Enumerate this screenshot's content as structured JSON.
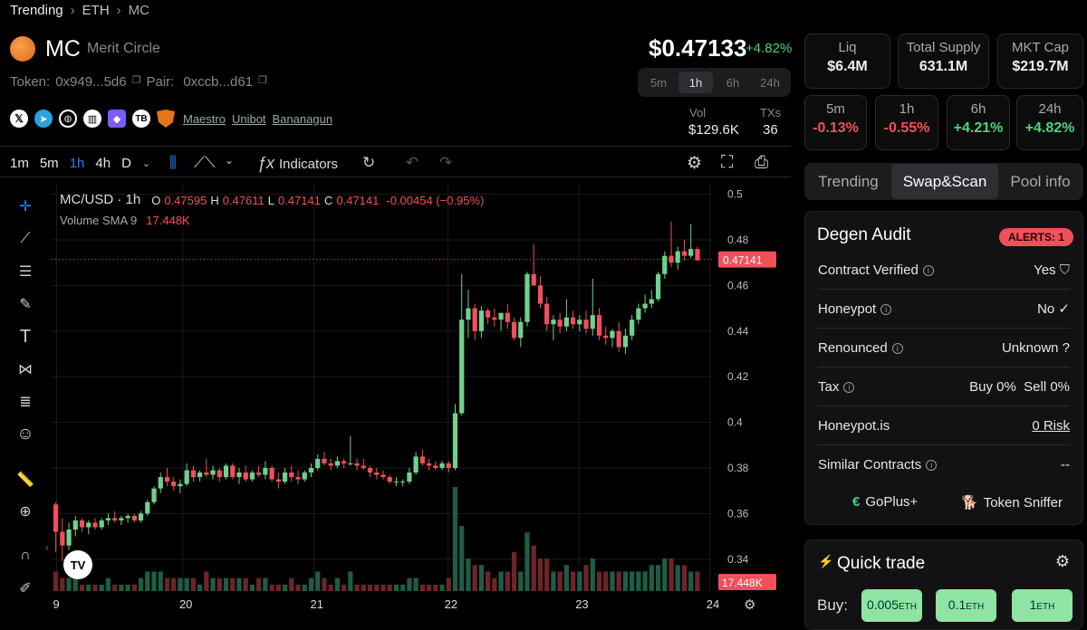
{
  "breadcrumb": {
    "items": [
      "Trending",
      "ETH",
      "MC"
    ]
  },
  "token": {
    "symbol": "MC",
    "name": "Merit Circle",
    "token_label": "Token:",
    "token_addr": "0x949...5d6",
    "pair_label": "Pair:",
    "pair_addr": "0xccb...d61",
    "price": "$0.47133",
    "change": "+4.82%"
  },
  "links": [
    "Maestro",
    "Unibot",
    "Bananagun"
  ],
  "timeframes": {
    "options": [
      "5m",
      "1h",
      "6h",
      "24h"
    ],
    "selected": "1h"
  },
  "vol": {
    "label": "Vol",
    "value": "$129.6K"
  },
  "txs": {
    "label": "TXs",
    "value": "36"
  },
  "stats_top": [
    {
      "label": "Liq",
      "value": "$6.4M"
    },
    {
      "label": "Total Supply",
      "value": "631.1M"
    },
    {
      "label": "MKT Cap",
      "value": "$219.7M"
    }
  ],
  "stats_changes": [
    {
      "label": "5m",
      "value": "-0.13%",
      "dir": "down"
    },
    {
      "label": "1h",
      "value": "-0.55%",
      "dir": "down"
    },
    {
      "label": "6h",
      "value": "+4.21%",
      "dir": "up"
    },
    {
      "label": "24h",
      "value": "+4.82%",
      "dir": "up"
    }
  ],
  "panel_tabs": {
    "items": [
      "Trending",
      "Swap&Scan",
      "Pool info"
    ],
    "selected": "Swap&Scan"
  },
  "audit": {
    "title": "Degen Audit",
    "alerts": "ALERTS: 1",
    "rows": [
      {
        "label": "Contract Verified",
        "value": "Yes",
        "mark": "shield"
      },
      {
        "label": "Honeypot",
        "value": "No",
        "mark": "check"
      },
      {
        "label": "Renounced",
        "value": "Unknown ?",
        "mark": ""
      },
      {
        "label": "Tax",
        "value": "Buy 0%  Sell 0%",
        "mark": ""
      },
      {
        "label": "Honeypot.is",
        "value": "0 Risk",
        "mark": "link"
      },
      {
        "label": "Similar Contracts",
        "value": "--",
        "mark": ""
      }
    ],
    "providers": [
      "GoPlus+",
      "Token Sniffer"
    ]
  },
  "quick_trade": {
    "title": "Quick trade",
    "buy_label": "Buy:",
    "amounts": [
      {
        "num": "0.005",
        "unit": "ETH"
      },
      {
        "num": "0.1",
        "unit": "ETH"
      },
      {
        "num": "1",
        "unit": "ETH"
      }
    ]
  },
  "chart_toolbar": {
    "intervals": [
      "1m",
      "5m",
      "1h",
      "4h",
      "D"
    ],
    "selected_interval": "1h",
    "indicators_label": "Indicators"
  },
  "legend": {
    "pair": "MC/USD · 1h",
    "o_label": "O",
    "o": "0.47595",
    "h_label": "H",
    "h": "0.47611",
    "l_label": "L",
    "l": "0.47141",
    "c_label": "C",
    "c": "0.47141",
    "change": "-0.00454 (−0.95%)",
    "volume_label": "Volume SMA 9",
    "volume_value": "17.448K"
  },
  "chart_data": {
    "type": "candlestick",
    "y_ticks": [
      "0.5",
      "0.48",
      "0.46",
      "0.44",
      "0.42",
      "0.4",
      "0.38",
      "0.36",
      "0.34"
    ],
    "ylim": [
      0.328,
      0.505
    ],
    "x_ticks": [
      "9",
      "20",
      "21",
      "22",
      "23",
      "24"
    ],
    "last_price_label": "0.47141",
    "last_volume_label": "17.448K",
    "candles": [
      [
        0.364,
        0.365,
        0.343,
        0.352
      ],
      [
        0.352,
        0.358,
        0.339,
        0.346
      ],
      [
        0.346,
        0.356,
        0.344,
        0.353
      ],
      [
        0.353,
        0.359,
        0.35,
        0.357
      ],
      [
        0.357,
        0.358,
        0.352,
        0.354
      ],
      [
        0.354,
        0.357,
        0.351,
        0.356
      ],
      [
        0.356,
        0.358,
        0.353,
        0.354
      ],
      [
        0.354,
        0.358,
        0.353,
        0.357
      ],
      [
        0.357,
        0.36,
        0.355,
        0.358
      ],
      [
        0.358,
        0.361,
        0.356,
        0.357
      ],
      [
        0.357,
        0.359,
        0.355,
        0.358
      ],
      [
        0.358,
        0.36,
        0.356,
        0.359
      ],
      [
        0.359,
        0.36,
        0.356,
        0.357
      ],
      [
        0.357,
        0.361,
        0.356,
        0.36
      ],
      [
        0.36,
        0.366,
        0.359,
        0.365
      ],
      [
        0.365,
        0.372,
        0.364,
        0.371
      ],
      [
        0.371,
        0.378,
        0.369,
        0.376
      ],
      [
        0.376,
        0.38,
        0.372,
        0.374
      ],
      [
        0.374,
        0.376,
        0.37,
        0.372
      ],
      [
        0.372,
        0.375,
        0.369,
        0.373
      ],
      [
        0.373,
        0.382,
        0.372,
        0.379
      ],
      [
        0.379,
        0.381,
        0.374,
        0.376
      ],
      [
        0.376,
        0.379,
        0.374,
        0.378
      ],
      [
        0.378,
        0.384,
        0.376,
        0.377
      ],
      [
        0.377,
        0.381,
        0.375,
        0.379
      ],
      [
        0.379,
        0.38,
        0.374,
        0.376
      ],
      [
        0.376,
        0.382,
        0.375,
        0.381
      ],
      [
        0.381,
        0.382,
        0.375,
        0.376
      ],
      [
        0.376,
        0.38,
        0.373,
        0.378
      ],
      [
        0.378,
        0.381,
        0.374,
        0.375
      ],
      [
        0.375,
        0.379,
        0.374,
        0.378
      ],
      [
        0.378,
        0.381,
        0.376,
        0.377
      ],
      [
        0.377,
        0.383,
        0.375,
        0.38
      ],
      [
        0.38,
        0.381,
        0.374,
        0.375
      ],
      [
        0.375,
        0.378,
        0.371,
        0.374
      ],
      [
        0.374,
        0.38,
        0.373,
        0.378
      ],
      [
        0.378,
        0.381,
        0.374,
        0.376
      ],
      [
        0.376,
        0.379,
        0.373,
        0.375
      ],
      [
        0.375,
        0.379,
        0.374,
        0.378
      ],
      [
        0.378,
        0.382,
        0.376,
        0.38
      ],
      [
        0.38,
        0.386,
        0.379,
        0.384
      ],
      [
        0.384,
        0.387,
        0.381,
        0.382
      ],
      [
        0.382,
        0.384,
        0.379,
        0.381
      ],
      [
        0.381,
        0.385,
        0.38,
        0.383
      ],
      [
        0.383,
        0.384,
        0.38,
        0.382
      ],
      [
        0.382,
        0.394,
        0.381,
        0.382
      ],
      [
        0.382,
        0.384,
        0.379,
        0.381
      ],
      [
        0.381,
        0.384,
        0.379,
        0.38
      ],
      [
        0.38,
        0.381,
        0.376,
        0.378
      ],
      [
        0.378,
        0.38,
        0.375,
        0.377
      ],
      [
        0.377,
        0.379,
        0.375,
        0.376
      ],
      [
        0.376,
        0.377,
        0.373,
        0.374
      ],
      [
        0.374,
        0.376,
        0.372,
        0.374
      ],
      [
        0.374,
        0.375,
        0.372,
        0.374
      ],
      [
        0.374,
        0.38,
        0.373,
        0.378
      ],
      [
        0.378,
        0.387,
        0.377,
        0.385
      ],
      [
        0.385,
        0.388,
        0.381,
        0.382
      ],
      [
        0.382,
        0.384,
        0.379,
        0.381
      ],
      [
        0.381,
        0.383,
        0.379,
        0.38
      ],
      [
        0.38,
        0.383,
        0.379,
        0.382
      ],
      [
        0.382,
        0.383,
        0.378,
        0.38
      ],
      [
        0.38,
        0.408,
        0.379,
        0.404
      ],
      [
        0.404,
        0.465,
        0.403,
        0.445
      ],
      [
        0.445,
        0.458,
        0.437,
        0.45
      ],
      [
        0.45,
        0.452,
        0.436,
        0.44
      ],
      [
        0.44,
        0.451,
        0.437,
        0.449
      ],
      [
        0.449,
        0.45,
        0.443,
        0.446
      ],
      [
        0.446,
        0.45,
        0.442,
        0.445
      ],
      [
        0.445,
        0.447,
        0.44,
        0.448
      ],
      [
        0.448,
        0.452,
        0.441,
        0.444
      ],
      [
        0.444,
        0.446,
        0.436,
        0.437
      ],
      [
        0.437,
        0.446,
        0.433,
        0.444
      ],
      [
        0.444,
        0.466,
        0.442,
        0.465
      ],
      [
        0.465,
        0.478,
        0.462,
        0.46
      ],
      [
        0.46,
        0.464,
        0.45,
        0.452
      ],
      [
        0.452,
        0.455,
        0.44,
        0.443
      ],
      [
        0.443,
        0.447,
        0.436,
        0.445
      ],
      [
        0.445,
        0.448,
        0.439,
        0.442
      ],
      [
        0.442,
        0.454,
        0.44,
        0.446
      ],
      [
        0.446,
        0.449,
        0.441,
        0.443
      ],
      [
        0.443,
        0.447,
        0.44,
        0.445
      ],
      [
        0.445,
        0.449,
        0.439,
        0.441
      ],
      [
        0.441,
        0.463,
        0.438,
        0.447
      ],
      [
        0.447,
        0.45,
        0.436,
        0.438
      ],
      [
        0.438,
        0.442,
        0.434,
        0.437
      ],
      [
        0.437,
        0.441,
        0.433,
        0.44
      ],
      [
        0.44,
        0.444,
        0.431,
        0.433
      ],
      [
        0.433,
        0.441,
        0.43,
        0.438
      ],
      [
        0.438,
        0.447,
        0.436,
        0.445
      ],
      [
        0.445,
        0.452,
        0.443,
        0.45
      ],
      [
        0.45,
        0.456,
        0.448,
        0.452
      ],
      [
        0.452,
        0.458,
        0.45,
        0.454
      ],
      [
        0.454,
        0.466,
        0.453,
        0.465
      ],
      [
        0.465,
        0.475,
        0.463,
        0.473
      ],
      [
        0.473,
        0.488,
        0.468,
        0.47
      ],
      [
        0.47,
        0.477,
        0.467,
        0.475
      ],
      [
        0.475,
        0.48,
        0.471,
        0.473
      ],
      [
        0.473,
        0.487,
        0.472,
        0.476
      ],
      [
        0.476,
        0.477,
        0.471,
        0.471
      ]
    ],
    "volumes": [
      0.3,
      0.2,
      0.2,
      0.2,
      0.1,
      0.1,
      0.1,
      0.1,
      0.2,
      0.1,
      0.1,
      0.1,
      0.1,
      0.2,
      0.3,
      0.3,
      0.3,
      0.2,
      0.2,
      0.2,
      0.2,
      0.2,
      0.1,
      0.3,
      0.2,
      0.2,
      0.2,
      0.2,
      0.2,
      0.2,
      0.1,
      0.2,
      0.2,
      0.1,
      0.1,
      0.1,
      0.2,
      0.1,
      0.1,
      0.2,
      0.3,
      0.2,
      0.1,
      0.2,
      0.1,
      0.3,
      0.1,
      0.1,
      0.1,
      0.1,
      0.1,
      0.1,
      0.1,
      0.1,
      0.2,
      0.2,
      0.1,
      0.1,
      0.1,
      0.1,
      0.2,
      1.6,
      1.0,
      0.5,
      0.4,
      0.4,
      0.3,
      0.2,
      0.3,
      0.3,
      0.6,
      0.3,
      0.9,
      0.7,
      0.5,
      0.5,
      0.3,
      0.3,
      0.4,
      0.3,
      0.3,
      0.4,
      0.5,
      0.3,
      0.3,
      0.3,
      0.3,
      0.3,
      0.3,
      0.3,
      0.3,
      0.4,
      0.4,
      0.5,
      0.5,
      0.4,
      0.4,
      0.3,
      0.3
    ]
  }
}
